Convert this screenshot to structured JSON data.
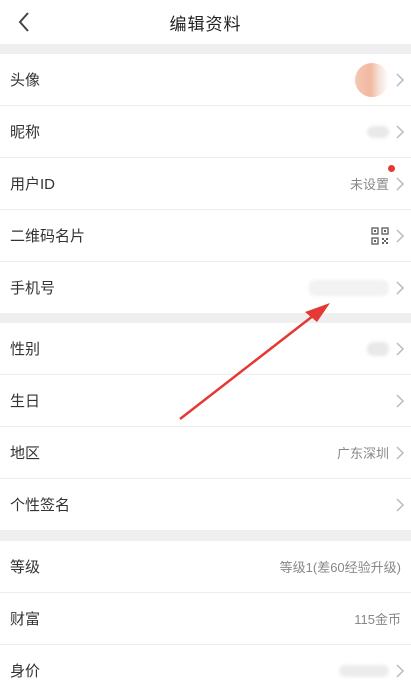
{
  "header": {
    "title": "编辑资料"
  },
  "section1": [
    {
      "label": "头像",
      "value": ""
    },
    {
      "label": "昵称",
      "value": ""
    },
    {
      "label": "用户ID",
      "value": "未设置"
    },
    {
      "label": "二维码名片",
      "value": ""
    },
    {
      "label": "手机号",
      "value": ""
    }
  ],
  "section2": [
    {
      "label": "性别",
      "value": ""
    },
    {
      "label": "生日",
      "value": ""
    },
    {
      "label": "地区",
      "value": "广东深圳"
    },
    {
      "label": "个性签名",
      "value": ""
    }
  ],
  "section3": [
    {
      "label": "等级",
      "value": "等级1(差60经验升级)"
    },
    {
      "label": "财富",
      "value": "115金币"
    },
    {
      "label": "身价",
      "value": ""
    }
  ],
  "colors": {
    "accent_red": "#e53935",
    "annotation_arrow": "#e53935"
  },
  "icons": {
    "back": "chevron-left-icon",
    "chevron": "chevron-right-icon",
    "qrcode": "qr-code-icon"
  }
}
